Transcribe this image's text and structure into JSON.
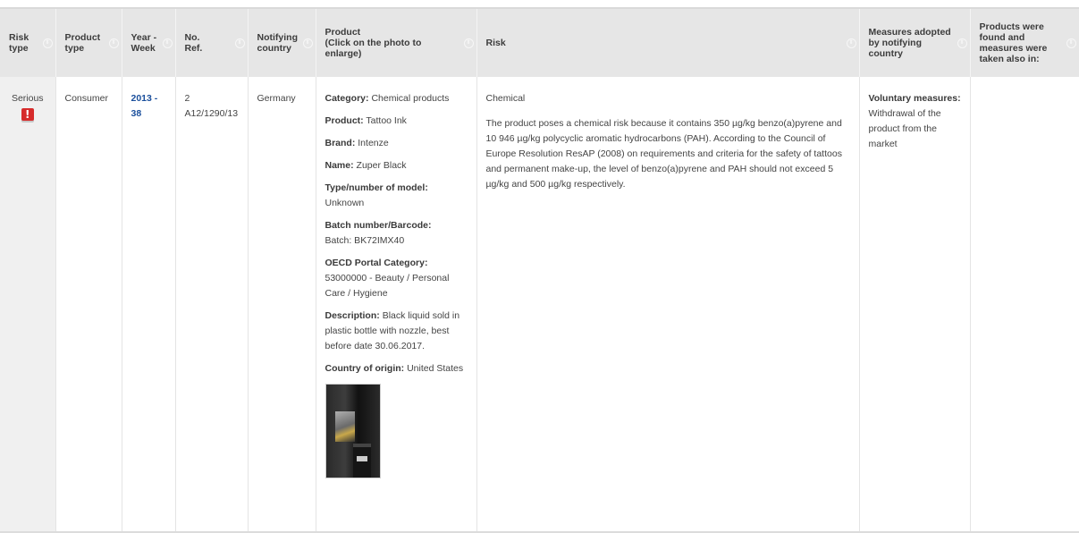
{
  "headers": {
    "risk_type": [
      "Risk",
      "type"
    ],
    "product_type": [
      "Product",
      "type"
    ],
    "year_week": [
      "Year -",
      "Week"
    ],
    "ref": [
      "No.",
      "Ref."
    ],
    "notifying_country": [
      "Notifying",
      "country"
    ],
    "product": [
      "Product",
      "(Click on the photo to",
      "enlarge)"
    ],
    "risk": [
      "Risk"
    ],
    "measures": [
      "Measures adopted",
      "by notifying country"
    ],
    "also_in": [
      "Products were",
      "found and",
      "measures were",
      "taken also in:"
    ]
  },
  "row": {
    "risk_type": "Serious",
    "risk_badge": "!",
    "product_type": "Consumer",
    "year_week_line1": "2013 -",
    "year_week_line2": "38",
    "ref_line1": "2",
    "ref_line2": "A12/1290/13",
    "notifying_country": "Germany",
    "product": {
      "category_label": "Category:",
      "category": "Chemical products",
      "product_label": "Product:",
      "product": "Tattoo Ink",
      "brand_label": "Brand:",
      "brand": "Intenze",
      "name_label": "Name:",
      "name": "Zuper Black",
      "model_label": "Type/number of model:",
      "model": "Unknown",
      "batch_label": "Batch number/Barcode:",
      "batch": "Batch: BK72IMX40",
      "oecd_label": "OECD Portal Category:",
      "oecd": "53000000 - Beauty / Personal Care / Hygiene",
      "description_label": "Description:",
      "description": "Black liquid sold in plastic bottle with nozzle, best before date 30.06.2017.",
      "origin_label": "Country of origin:",
      "origin": "United States"
    },
    "risk_category": "Chemical",
    "risk_text": "The product poses a chemical risk because it contains 350 µg/kg benzo(a)pyrene and 10 946 µg/kg polycyclic aromatic hydrocarbons (PAH). According to the Council of Europe Resolution ResAP (2008) on requirements and criteria for the safety of tattoos and permanent make-up, the level of benzo(a)pyrene and PAH should not exceed 5 µg/kg and 500 µg/kg respectively.",
    "measures_label": "Voluntary measures:",
    "measures_text": "Withdrawal of the product from the market",
    "also_in": ""
  },
  "icons": {
    "sort": "sort-icon",
    "warning": "warning-icon",
    "photo": "product-photo"
  },
  "colors": {
    "header_bg": "#e6e6e6",
    "link": "#1a4f9c",
    "serious_badge": "#d62b2b"
  }
}
